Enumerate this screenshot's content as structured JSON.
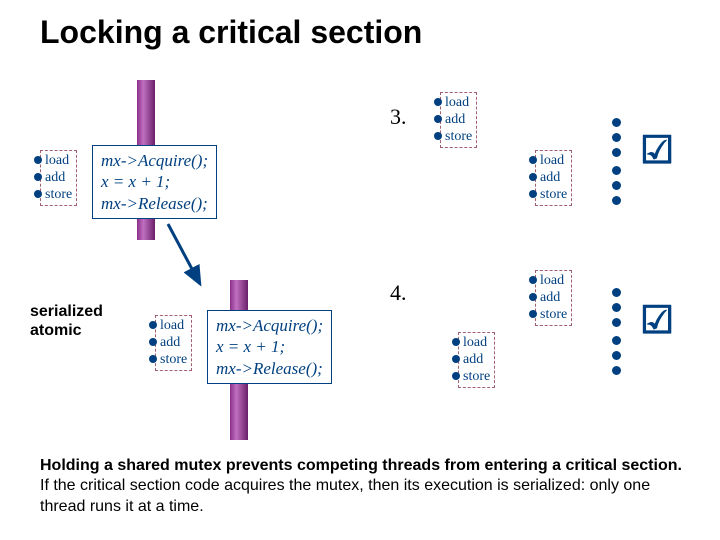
{
  "title": "Locking a critical section",
  "steps": {
    "three": "3.",
    "four": "4."
  },
  "las": {
    "l1": "load",
    "l2": "add",
    "l3": "store"
  },
  "code": {
    "acq": "mx->Acquire();",
    "inc": "x = x + 1;",
    "rel": "mx->Release();"
  },
  "labels": {
    "serialized": "serialized",
    "atomic": "atomic"
  },
  "check": "☑",
  "footer": {
    "b": "Holding a shared mutex prevents competing threads from entering a critical section.",
    "r": "  If the critical section code acquires the mutex, then its execution is serialized: only one thread runs it at a time."
  }
}
